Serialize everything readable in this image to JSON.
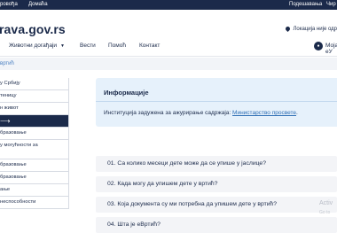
{
  "topbar": {
    "left_links": [
      "ровођа",
      "Домаћа"
    ],
    "right_links": [
      "Подешавања",
      "Чир"
    ]
  },
  "header": {
    "logo": "rava.gov.rs",
    "location_text": "Локација није одр"
  },
  "nav": {
    "items": [
      "Животни догађаји",
      "Вести",
      "Помоћ",
      "Контакт"
    ],
    "user_label": "Моја еУ"
  },
  "breadcrumb": "вртић",
  "sidebar": {
    "items": [
      "у Србију",
      "теницу",
      "н живот",
      "",
      "бразовање",
      "у могућности за",
      "бразовање",
      "бразовање",
      "ање",
      "неспособности"
    ]
  },
  "info": {
    "title": "Информације",
    "body_prefix": "Институција задужена за ажурирање садржаја: ",
    "link_text": "Министарство просвете",
    "body_suffix": "."
  },
  "faq": [
    "01. Са колико месеци дете може да се упише у јаслице?",
    "02. Када могу да упишем дете у вртић?",
    "03. Која документа су ми потребна да упишем дете у вртић?",
    "04. Шта је еВртић?"
  ],
  "watermark": {
    "line1": "Activ",
    "line2": "Go to"
  }
}
